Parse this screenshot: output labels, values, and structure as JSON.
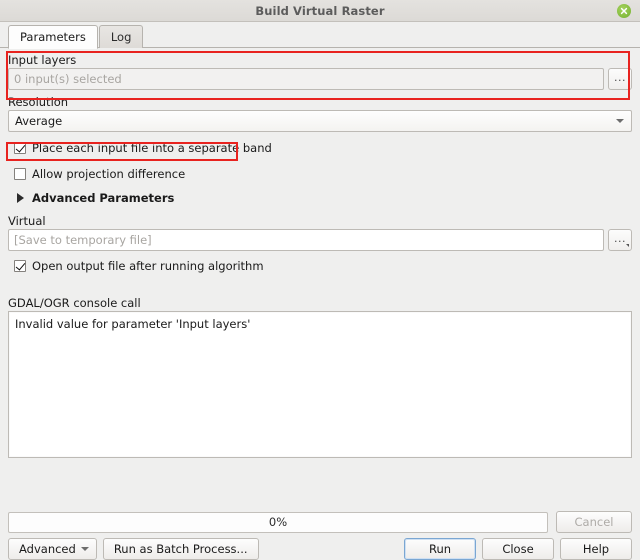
{
  "window": {
    "title": "Build Virtual Raster",
    "close_icon": "close-icon"
  },
  "tabs": [
    {
      "label": "Parameters",
      "active": true
    },
    {
      "label": "Log",
      "active": false
    }
  ],
  "parameters": {
    "input_layers": {
      "label": "Input layers",
      "value": "",
      "placeholder": "0 input(s) selected",
      "browse_label": "...",
      "highlighted": true
    },
    "resolution": {
      "label": "Resolution",
      "selected": "Average"
    },
    "separate_band": {
      "label": "Place each input file into a separate band",
      "checked": true,
      "highlighted": true
    },
    "projection_difference": {
      "label": "Allow projection difference",
      "checked": false
    },
    "advanced_parameters": {
      "label": "Advanced Parameters",
      "expanded": false
    },
    "virtual": {
      "label": "Virtual",
      "value": "",
      "placeholder": "[Save to temporary file]",
      "browse_label": "..."
    },
    "open_output": {
      "label": "Open output file after running algorithm",
      "checked": true
    },
    "console": {
      "label": "GDAL/OGR console call",
      "text": "Invalid value for parameter 'Input layers'"
    }
  },
  "footer": {
    "progress_text": "0%",
    "progress_percent": 0,
    "cancel_label": "Cancel",
    "advanced_label": "Advanced",
    "batch_label": "Run as Batch Process...",
    "run_label": "Run",
    "close_label": "Close",
    "help_label": "Help"
  },
  "colors": {
    "highlight": "#e8231f",
    "close_button": "#8cc63f",
    "default_button_border": "#7aa6d2"
  }
}
